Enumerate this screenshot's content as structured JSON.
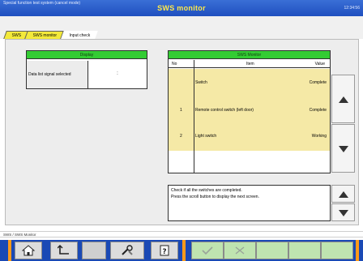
{
  "window": {
    "path": "Special function test system (cancel mode)",
    "title": "SWS monitor",
    "clock": "12:34:56"
  },
  "tabs": [
    {
      "label": "SWS"
    },
    {
      "label": "SWS monitor"
    },
    {
      "label": "Input check"
    }
  ],
  "left_table": {
    "header": "Display",
    "row_label": "Data list signal selected",
    "row_value": ":"
  },
  "right_table": {
    "header": "SWS Monitor",
    "columns": [
      "No",
      "Item",
      "Value"
    ],
    "rows": [
      {
        "no": "",
        "item": "Switch",
        "value": "Complete"
      },
      {
        "no": "1",
        "item": "Remote control switch (left door)",
        "value": "Complete"
      },
      {
        "no": "2",
        "item": "Light switch",
        "value": "Working"
      }
    ]
  },
  "message": {
    "line1": "Check if all the switches are completed.",
    "line2": "Press the scroll button to display the next screen."
  },
  "status": {
    "text": "SWS / SWS Monitor"
  },
  "colors": {
    "title_bar": "#1f4fbf",
    "title_text": "#ffe94a",
    "header_green": "#33cc33",
    "row_yellow": "#f5e9a6",
    "toolbar": "#1a49b5",
    "separator": "#ff9a1a"
  },
  "toolbar": {
    "icons": [
      "home-icon",
      "back-icon",
      "tools-icon",
      "help-icon",
      "ok-icon",
      "cancel-icon"
    ]
  }
}
